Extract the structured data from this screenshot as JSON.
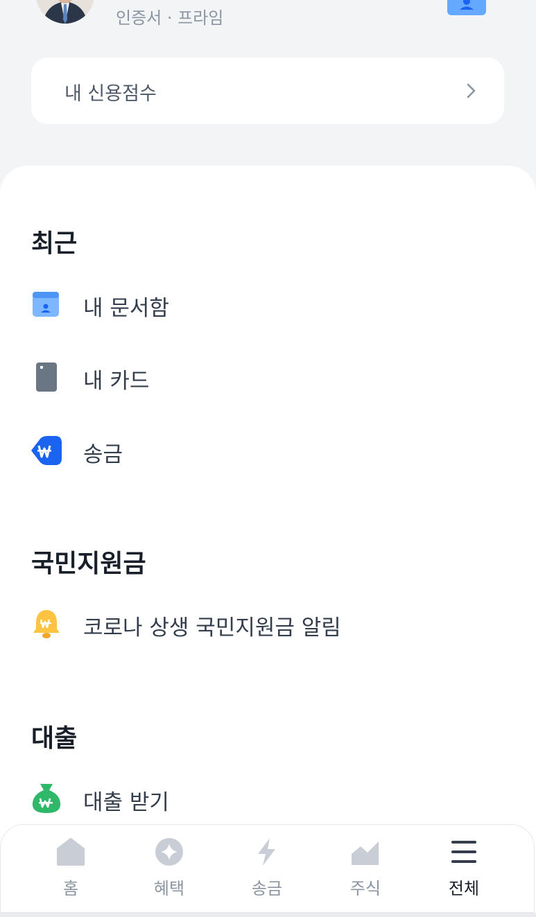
{
  "profile": {
    "subtitle": "인증서 · 프라임"
  },
  "credit": {
    "label": "내 신용점수"
  },
  "sections": {
    "recent": {
      "title": "최근",
      "items": [
        {
          "label": "내 문서함",
          "icon": "document-box-icon"
        },
        {
          "label": "내 카드",
          "icon": "card-icon"
        },
        {
          "label": "송금",
          "icon": "won-transfer-icon"
        }
      ]
    },
    "support": {
      "title": "국민지원금",
      "items": [
        {
          "label": "코로나 상생 국민지원금 알림",
          "icon": "bell-won-icon"
        }
      ]
    },
    "loan": {
      "title": "대출",
      "items": [
        {
          "label": "대출 받기",
          "icon": "money-bag-icon"
        }
      ]
    }
  },
  "tabbar": {
    "tabs": [
      {
        "label": "홈",
        "icon": "home-icon",
        "active": false
      },
      {
        "label": "혜택",
        "icon": "benefit-icon",
        "active": false
      },
      {
        "label": "송금",
        "icon": "lightning-icon",
        "active": false
      },
      {
        "label": "주식",
        "icon": "stock-icon",
        "active": false
      },
      {
        "label": "전체",
        "icon": "menu-icon",
        "active": true
      }
    ]
  },
  "colors": {
    "background": "#f2f4f6",
    "blue": "#1b64f2",
    "light_blue": "#64a8ff",
    "card_gray": "#6b7684",
    "bell_yellow": "#ffc342",
    "bag_green": "#2fb86a",
    "text_primary": "#191f28",
    "text_secondary": "#8b95a1"
  }
}
